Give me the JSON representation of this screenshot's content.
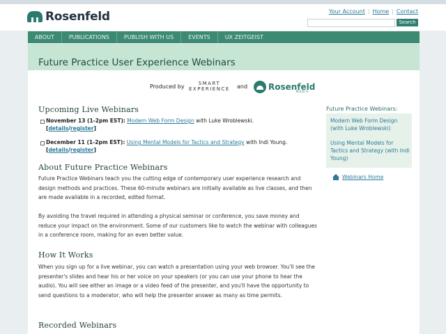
{
  "header": {
    "logo_text": "Rosenfeld",
    "top_links": [
      "Your Account",
      "Home",
      "Contact"
    ],
    "search_button": "Search"
  },
  "nav": [
    "ABOUT",
    "PUBLICATIONS",
    "PUBLISH WITH US",
    "EVENTS",
    "UX ZEITGEIST"
  ],
  "banner": {
    "title": "Future Practice User Experience Webinars"
  },
  "produced": {
    "label": "Produced by",
    "smart_line1": "SMART",
    "smart_line2": "EXPERIENCE",
    "and": "and",
    "rosenfeld": "Rosenfeld",
    "rosenfeld_sub": "MEDIA"
  },
  "upcoming": {
    "heading": "Upcoming Live Webinars",
    "items": [
      {
        "date": "November 13 (1-2pm EST):",
        "title": "Modern Web Form Design",
        "rest": " with Luke Wroblewski.",
        "details": "details",
        "register": "register"
      },
      {
        "date": "December 11 (1-2pm EST):",
        "title": "Using Mental Models for Tactics and Strategy",
        "rest": " with Indi Young.",
        "details": "details",
        "register": "register"
      }
    ]
  },
  "about": {
    "heading": "About Future Practice Webinars",
    "p1": "Future Practice Webinars teach you the cutting edge of contemporary user experience research and design methods and practices. These 60-minute webinars are initially available as live classes, and then are made available in a recorded, edited format.",
    "p2": "By avoiding the travel required in attending a physical seminar or conference, you save money and reduce your impact on the environment. Some of our customers like to watch the webinar with colleagues in a conference room, making for an even better value."
  },
  "how": {
    "heading": "How It Works",
    "p1": "When you sign up for a live webinar, you can watch a presentation using your web browser. You'll see the presenter's slides and hear his or her voice on your speakers (or you can use your phone to hear the audio). You will see either an image or a video feed of the presenter, and you'll have the opportunity to send questions to a moderator, who will help the presenter answer as many as time permits."
  },
  "recorded": {
    "heading": "Recorded Webinars"
  },
  "sidebar": {
    "title": "Future Practice Webinars:",
    "links": [
      "Modern Web Form Design (with Luke Wroblewski)",
      "Using Mental Models for Tactics and Strategy (with Indi Young)"
    ],
    "home_link": "Webinars Home"
  }
}
